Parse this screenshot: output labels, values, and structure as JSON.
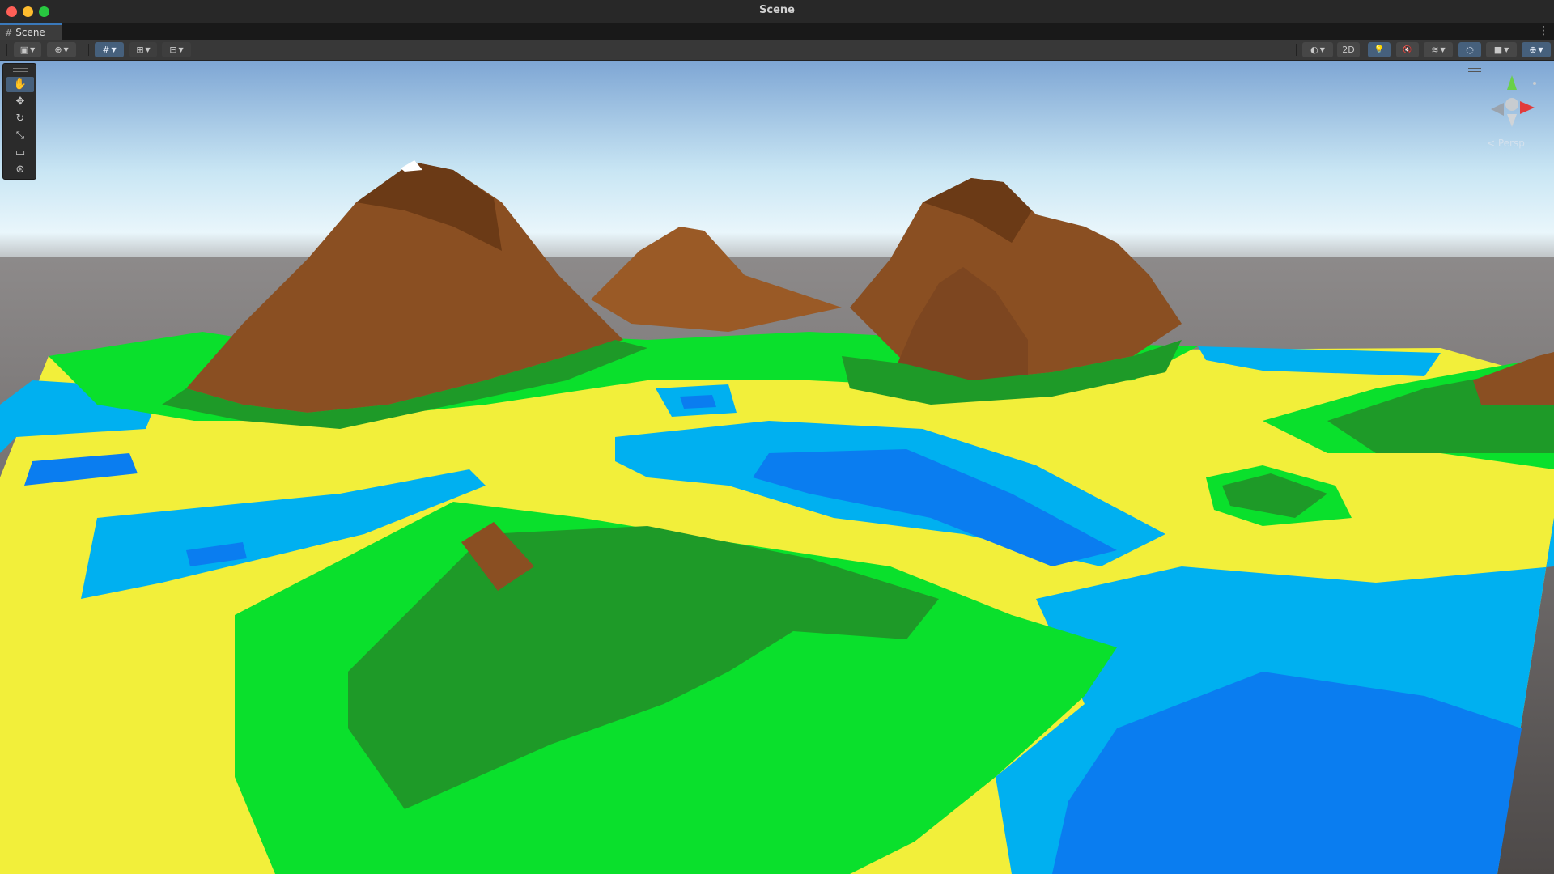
{
  "window": {
    "title": "Scene"
  },
  "tab": {
    "label": "Scene",
    "icon": "grid-icon",
    "menu_icon": "⋮"
  },
  "toolbar": {
    "left": [
      {
        "name": "draw-mode-dropdown",
        "icon": "▣"
      },
      {
        "name": "global-space-dropdown",
        "icon": "⊕"
      },
      {
        "name": "grid-snap-toggle",
        "icon": "#"
      },
      {
        "name": "increment-snap-dropdown",
        "icon": "⊞"
      },
      {
        "name": "snap-settings-dropdown",
        "icon": "⊟"
      }
    ],
    "right": [
      {
        "name": "shading-mode-dropdown",
        "icon": "◐"
      },
      {
        "name": "2d-toggle",
        "label": "2D"
      },
      {
        "name": "lighting-toggle",
        "icon": "💡"
      },
      {
        "name": "audio-toggle",
        "icon": "🔇"
      },
      {
        "name": "effects-dropdown",
        "icon": "≋"
      },
      {
        "name": "hidden-objects-toggle",
        "icon": "◌"
      },
      {
        "name": "camera-dropdown",
        "icon": "■"
      },
      {
        "name": "gizmos-dropdown",
        "icon": "⊕"
      }
    ]
  },
  "tools": [
    {
      "name": "hand-tool",
      "icon": "✋",
      "active": true
    },
    {
      "name": "move-tool",
      "icon": "✥"
    },
    {
      "name": "rotate-tool",
      "icon": "↻"
    },
    {
      "name": "scale-tool",
      "icon": "⤡"
    },
    {
      "name": "rect-tool",
      "icon": "▭"
    },
    {
      "name": "transform-tool",
      "icon": "⊛"
    }
  ],
  "gizmo": {
    "projection_label": "< Persp"
  },
  "colors": {
    "sky_top": "#7ea6d4",
    "sky_horizon": "#e9f6fb",
    "ground": "#5a5655",
    "deep_water": "#0a7df0",
    "shallow_water": "#00b0f0",
    "sand": "#f2ef3a",
    "grass_light": "#0ae02c",
    "grass_dark": "#1e9a28",
    "mountain": "#8a4f22",
    "mountain_dark": "#6b3a16",
    "snow": "#ffffff"
  }
}
